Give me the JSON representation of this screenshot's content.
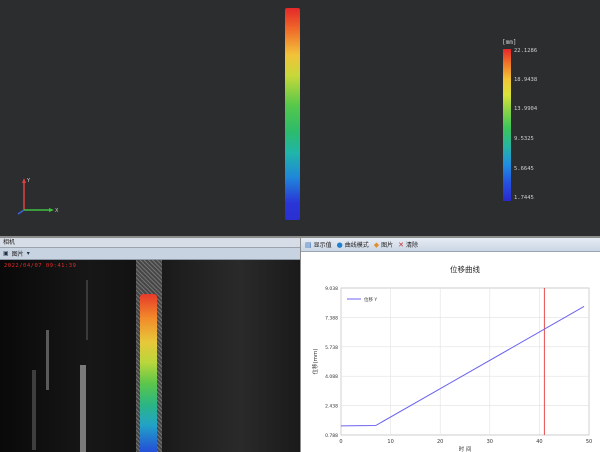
{
  "viewport3d": {
    "colorbar": {
      "unit": "[mm]",
      "ticks": [
        "22.1286",
        "18.9438",
        "13.9904",
        "9.5325",
        "5.6645",
        "1.7445"
      ],
      "colors": [
        "#e6262a",
        "#f2c636",
        "#3cc65a",
        "#1f8ee0",
        "#2a28cf"
      ]
    },
    "axes": {
      "x_label": "X",
      "y_label": "Y"
    }
  },
  "camera_panel": {
    "header_title": "相机",
    "toolbar": {
      "dropdown_glyph": "▾",
      "label": "图片"
    },
    "frame_overlay": "2022/04/07 09:41:39"
  },
  "chart_panel": {
    "toolbar": [
      {
        "icon": "chart-icon",
        "glyph": "▤",
        "label": "显示值"
      },
      {
        "icon": "globe-icon",
        "glyph": "●",
        "label": "曲线模式"
      },
      {
        "icon": "palette-icon",
        "glyph": "◆",
        "label": "图片"
      },
      {
        "icon": "close-icon",
        "glyph": "✕",
        "label": "清除"
      }
    ]
  },
  "chart_data": {
    "type": "line",
    "title": "位移曲线",
    "xlabel": "时 间",
    "ylabel": "位移(mm)",
    "legend": {
      "entries": [
        "位移 Y"
      ],
      "placement": "top-left"
    },
    "xlim": [
      0,
      50
    ],
    "ylim": [
      0.788,
      9.038
    ],
    "x_ticks": [
      "0",
      "10",
      "20",
      "30",
      "40",
      "50"
    ],
    "y_ticks": [
      "0.788",
      "2.438",
      "4.088",
      "5.738",
      "7.388",
      "9.038"
    ],
    "grid": true,
    "series": [
      {
        "name": "位移 Y",
        "color": "#6c63f0",
        "x": [
          0,
          7,
          49
        ],
        "y": [
          1.3,
          1.32,
          8.0
        ]
      }
    ],
    "marker_line": {
      "x": 41,
      "color": "#e23a3a"
    }
  }
}
